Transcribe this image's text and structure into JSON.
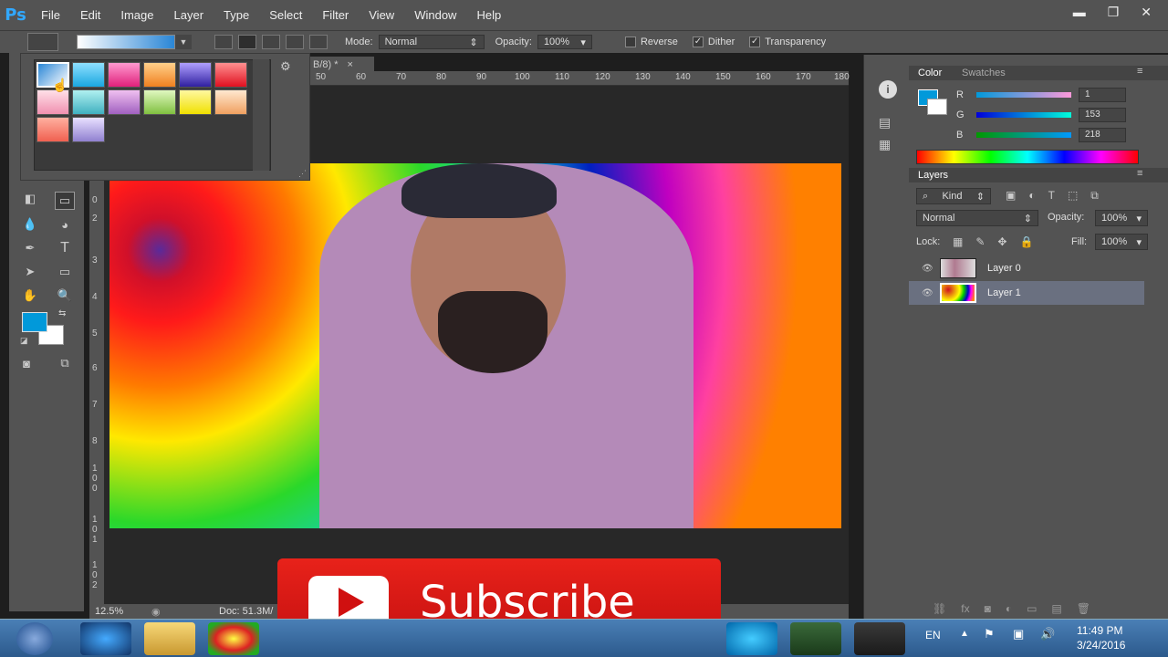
{
  "app": {
    "logo": "Ps"
  },
  "menu": [
    "File",
    "Edit",
    "Image",
    "Layer",
    "Type",
    "Select",
    "Filter",
    "View",
    "Window",
    "Help"
  ],
  "window_controls": {
    "minimize": "▬",
    "restore": "❐",
    "close": "✕"
  },
  "options": {
    "mode_label": "Mode:",
    "mode_value": "Normal",
    "opacity_label": "Opacity:",
    "opacity_value": "100%",
    "reverse_label": "Reverse",
    "dither_label": "Dither",
    "transparency_label": "Transparency",
    "reverse_checked": false,
    "dither_checked": true,
    "transparency_checked": true
  },
  "document": {
    "tab_title": "B/8) *",
    "tab_close": "×",
    "zoom": "12.5%",
    "doc_info": "Doc: 51.3M/"
  },
  "ruler": {
    "top_ticks": [
      "50",
      "60",
      "70",
      "80",
      "90",
      "100",
      "110",
      "120",
      "130",
      "140",
      "150",
      "160",
      "170",
      "180"
    ],
    "left_ticks": [
      "0",
      "2",
      "3",
      "4",
      "5",
      "6",
      "7",
      "8",
      "9",
      "1 0 0",
      "1 0 1",
      "1 0 2"
    ]
  },
  "gradient_picker": {
    "presets": [
      "blue-white",
      "cyan",
      "pink",
      "orange",
      "violet",
      "red",
      "light-pink",
      "teal",
      "purple",
      "green",
      "yellow",
      "peach",
      "salmon",
      "lavender"
    ],
    "gear_icon": "gear-icon"
  },
  "color_panel": {
    "tabs": [
      "Color",
      "Swatches"
    ],
    "channels": [
      {
        "label": "R",
        "value": "1"
      },
      {
        "label": "G",
        "value": "153"
      },
      {
        "label": "B",
        "value": "218"
      }
    ],
    "foreground": "#0199da",
    "background": "#ffffff"
  },
  "layers_panel": {
    "title": "Layers",
    "kind_label": "Kind",
    "blend_mode": "Normal",
    "opacity_label": "Opacity:",
    "opacity_value": "100%",
    "lock_label": "Lock:",
    "fill_label": "Fill:",
    "fill_value": "100%",
    "layers": [
      {
        "name": "Layer 0",
        "visible": true,
        "selected": false
      },
      {
        "name": "Layer 1",
        "visible": true,
        "selected": true
      }
    ]
  },
  "overlay": {
    "subscribe_label": "Subscribe"
  },
  "taskbar": {
    "language": "EN",
    "time": "11:49 PM",
    "date": "3/24/2016"
  },
  "colors": {
    "ui_panel": "#535353",
    "accent": "#31a8ff",
    "subscribe_red": "#e02018"
  }
}
